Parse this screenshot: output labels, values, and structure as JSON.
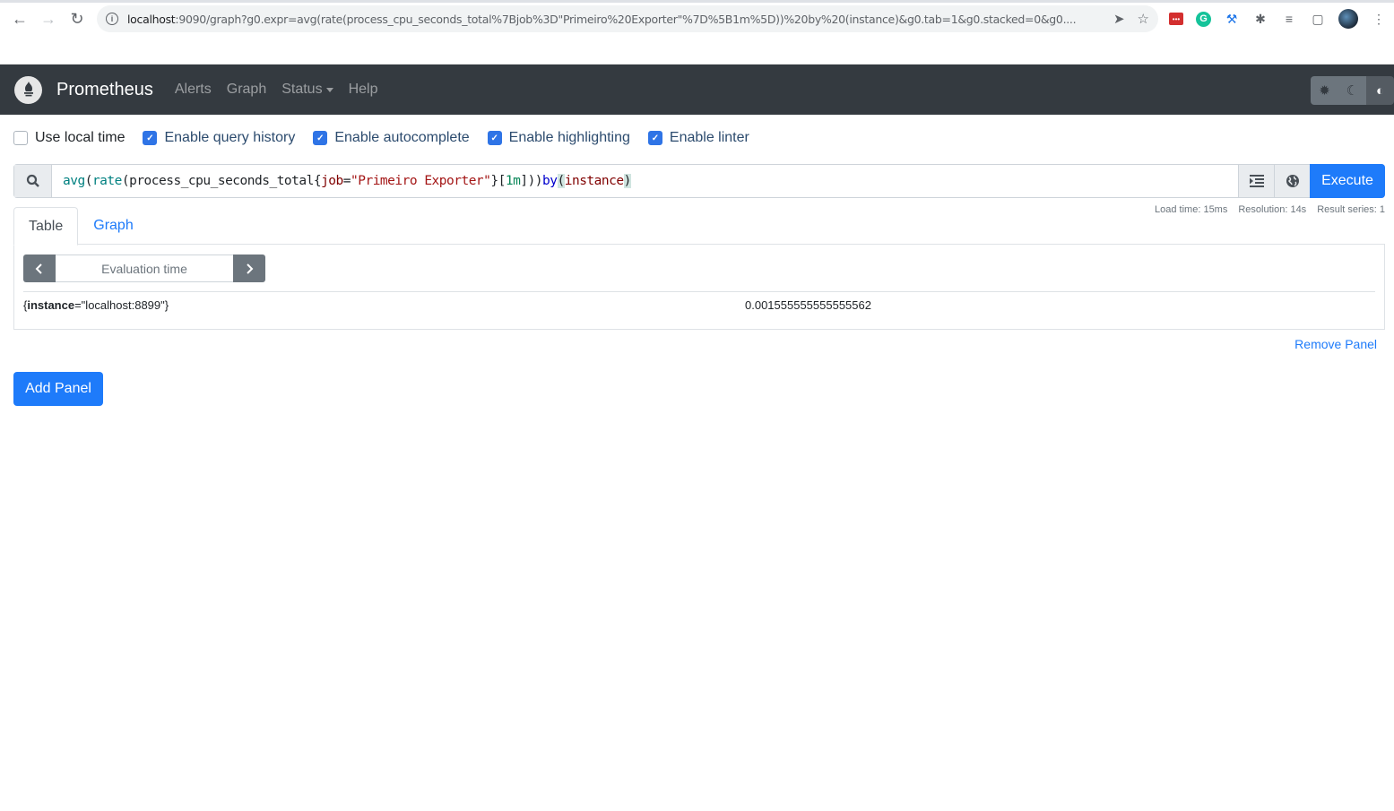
{
  "browser": {
    "url_host": "localhost",
    "url_rest": ":9090/graph?g0.expr=avg(rate(process_cpu_seconds_total%7Bjob%3D\"Primeiro%20Exporter\"%7D%5B1m%5D))%20by%20(instance)&g0.tab=1&g0.stacked=0&g0....",
    "extensions": [
      "lastpass-icon",
      "grammarly-icon",
      "dev-tool-icon",
      "extensions-icon",
      "media-icon",
      "sidepanel-icon"
    ]
  },
  "navbar": {
    "brand": "Prometheus",
    "links": [
      "Alerts",
      "Graph",
      "Status",
      "Help"
    ]
  },
  "options": [
    {
      "label": "Use local time",
      "checked": false
    },
    {
      "label": "Enable query history",
      "checked": true
    },
    {
      "label": "Enable autocomplete",
      "checked": true
    },
    {
      "label": "Enable highlighting",
      "checked": true
    },
    {
      "label": "Enable linter",
      "checked": true
    }
  ],
  "expression": {
    "tokens": {
      "avg": "avg",
      "p1": "(",
      "rate": "rate",
      "p2": "(",
      "metric": "process_cpu_seconds_total",
      "lb": "{",
      "label": "job",
      "eq": "=",
      "str": "\"Primeiro Exporter\"",
      "rb": "}",
      "sb1": "[",
      "dur": "1m",
      "sb2": "]",
      "p3": "))",
      "by": "by",
      "p4": "(",
      "inst": "instance",
      "p5": ")"
    },
    "execute_label": "Execute"
  },
  "panel": {
    "tabs": [
      "Table",
      "Graph"
    ],
    "active_tab": "Table",
    "stats": {
      "load_time": "Load time: 15ms",
      "resolution": "Resolution: 14s",
      "result_series": "Result series: 1"
    },
    "eval_placeholder": "Evaluation time",
    "results": [
      {
        "metric_open": "{",
        "label_name": "instance",
        "label_rest": "=\"localhost:8899\"}",
        "value": "0.001555555555555562"
      }
    ],
    "remove_label": "Remove Panel"
  },
  "add_panel_label": "Add Panel"
}
